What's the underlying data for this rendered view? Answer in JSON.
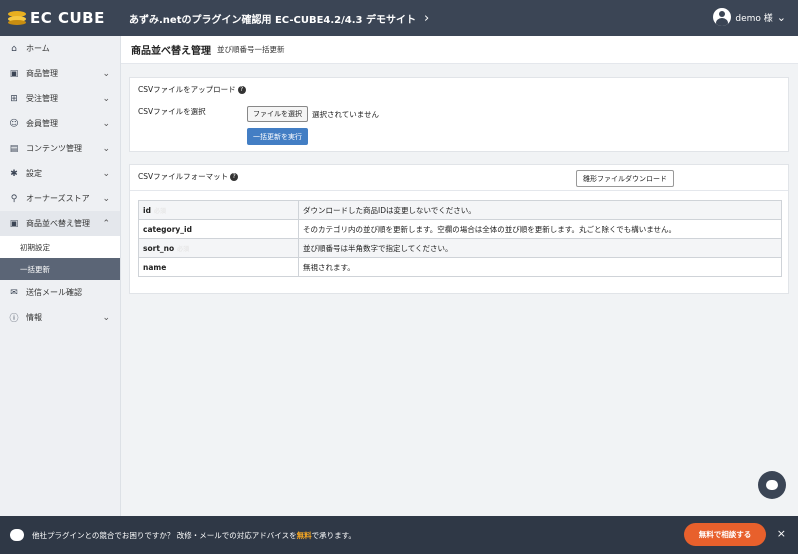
{
  "header": {
    "logo": "EC CUBE",
    "site_name": "あずみ.netのプラグイン確認用 EC-CUBE4.2/4.3 デモサイト",
    "user_name": "demo 様"
  },
  "sidebar": {
    "items": [
      {
        "label": "ホーム",
        "icon": "home-icon",
        "glyph": "⌂",
        "chevron": ""
      },
      {
        "label": "商品管理",
        "icon": "box-icon",
        "glyph": "▣",
        "chevron": "⌄"
      },
      {
        "label": "受注管理",
        "icon": "cart-icon",
        "glyph": "⊞",
        "chevron": "⌄"
      },
      {
        "label": "会員管理",
        "icon": "users-icon",
        "glyph": "☺",
        "chevron": "⌄"
      },
      {
        "label": "コンテンツ管理",
        "icon": "file-icon",
        "glyph": "▤",
        "chevron": "⌄"
      },
      {
        "label": "設定",
        "icon": "gear-icon",
        "glyph": "✱",
        "chevron": "⌄"
      },
      {
        "label": "オーナーズストア",
        "icon": "plug-icon",
        "glyph": "⚲",
        "chevron": "⌄"
      },
      {
        "label": "商品並べ替え管理",
        "icon": "box-icon",
        "glyph": "▣",
        "chevron": "⌃"
      }
    ],
    "sub_items": [
      {
        "label": "初期設定"
      },
      {
        "label": "一括更新"
      }
    ],
    "items_after": [
      {
        "label": "送信メール確認",
        "icon": "mail-icon",
        "glyph": "✉",
        "chevron": ""
      },
      {
        "label": "情報",
        "icon": "info-icon",
        "glyph": "ⓘ",
        "chevron": "⌄"
      }
    ]
  },
  "main": {
    "title": "商品並べ替え管理",
    "subtitle": "並び順番号一括更新",
    "upload_card": {
      "heading": "CSVファイルをアップロード",
      "field_label": "CSVファイルを選択",
      "file_button": "ファイルを選択",
      "file_status": "選択されていません",
      "submit_button": "一括更新を実行"
    },
    "format_card": {
      "heading": "CSVファイルフォーマット",
      "download_button": "雛形ファイルダウンロード",
      "rows": [
        {
          "key": "id",
          "badge": "必須",
          "desc": "ダウンロードした商品IDは変更しないでください。"
        },
        {
          "key": "category_id",
          "badge": "",
          "desc": "そのカテゴリ内の並び順を更新します。空欄の場合は全体の並び順を更新します。丸ごと除くでも構いません。"
        },
        {
          "key": "sort_no",
          "badge": "必須",
          "desc": "並び順番号は半角数字で指定してください。"
        },
        {
          "key": "name",
          "badge": "",
          "desc": "無視されます。"
        }
      ]
    }
  },
  "banner": {
    "text_before": "他社プラグインとの競合でお困りですか？ 改修・メールでの対応アドバイスを",
    "text_highlight": "無料",
    "text_after": "で承ります。",
    "cta": "無料で相談する",
    "close": "×"
  }
}
